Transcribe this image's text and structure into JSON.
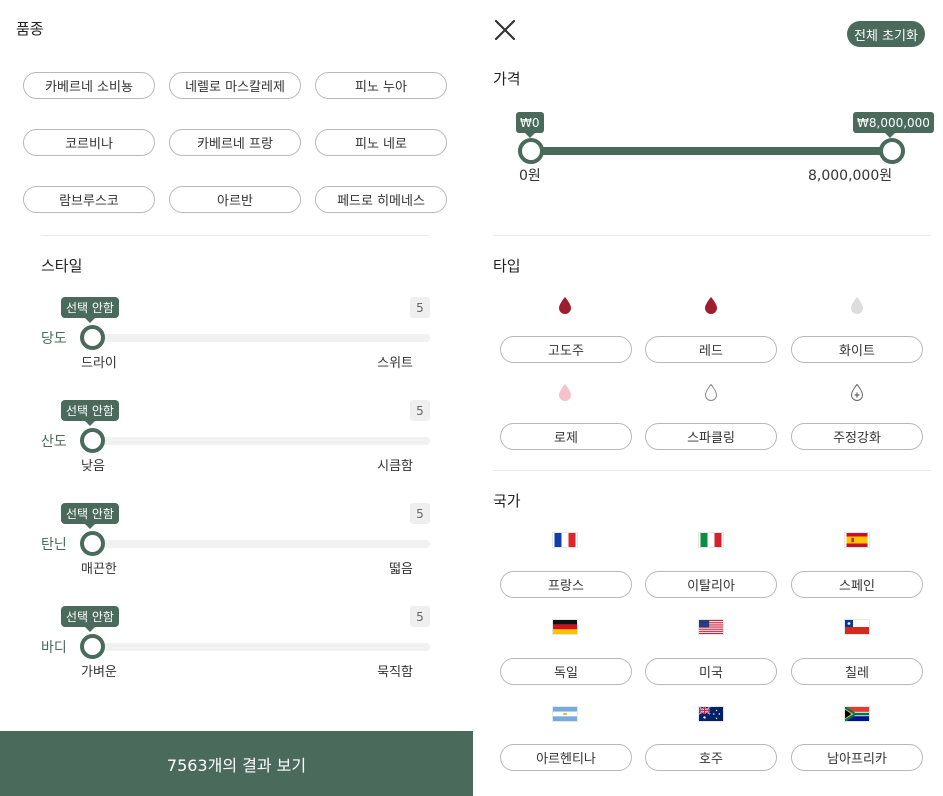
{
  "variety": {
    "title": "품종",
    "rows": [
      [
        "카베르네 소비뇽",
        "네렐로 마스칼레제",
        "피노 누아"
      ],
      [
        "코르비나",
        "카베르네 프랑",
        "피노 네로"
      ],
      [
        "람브루스코",
        "아르반",
        "페드로 히메네스"
      ]
    ]
  },
  "style": {
    "title": "스타일",
    "sliders": [
      {
        "badge": "선택 안함",
        "count": "5",
        "name": "당도",
        "low": "드라이",
        "high": "스위트"
      },
      {
        "badge": "선택 안함",
        "count": "5",
        "name": "산도",
        "low": "낮음",
        "high": "시큼함"
      },
      {
        "badge": "선택 안함",
        "count": "5",
        "name": "탄닌",
        "low": "매끈한",
        "high": "떫음"
      },
      {
        "badge": "선택 안함",
        "count": "5",
        "name": "바디",
        "low": "가벼운",
        "high": "묵직함"
      }
    ]
  },
  "result_button": "7563개의 결과 보기",
  "header": {
    "close_icon": "close-icon",
    "reset_label": "전체 초기화"
  },
  "price": {
    "title": "가격",
    "min_badge": "₩0",
    "max_badge": "₩8,000,000",
    "min_label": "0원",
    "max_label": "8,000,000원"
  },
  "type": {
    "title": "타입",
    "items": [
      {
        "label": "고도주",
        "icon": "drop-icon",
        "color": "#a01c2f"
      },
      {
        "label": "레드",
        "icon": "drop-icon",
        "color": "#a01c2f"
      },
      {
        "label": "화이트",
        "icon": "drop-icon",
        "color": "#dddddd"
      },
      {
        "label": "로제",
        "icon": "drop-icon",
        "color": "#f5c2cb"
      },
      {
        "label": "스파클링",
        "icon": "bubble-drop-icon",
        "color": "#999999"
      },
      {
        "label": "주정강화",
        "icon": "plus-drop-icon",
        "color": "#666666"
      }
    ]
  },
  "country": {
    "title": "국가",
    "items": [
      {
        "label": "프랑스",
        "flag": "france-flag-icon"
      },
      {
        "label": "이탈리아",
        "flag": "italy-flag-icon"
      },
      {
        "label": "스페인",
        "flag": "spain-flag-icon"
      },
      {
        "label": "독일",
        "flag": "germany-flag-icon"
      },
      {
        "label": "미국",
        "flag": "usa-flag-icon"
      },
      {
        "label": "칠레",
        "flag": "chile-flag-icon"
      },
      {
        "label": "아르헨티나",
        "flag": "argentina-flag-icon"
      },
      {
        "label": "호주",
        "flag": "australia-flag-icon"
      },
      {
        "label": "남아프리카",
        "flag": "south-africa-flag-icon"
      }
    ]
  },
  "colors": {
    "accent": "#4a6b5c",
    "wine_red": "#a01c2f"
  }
}
